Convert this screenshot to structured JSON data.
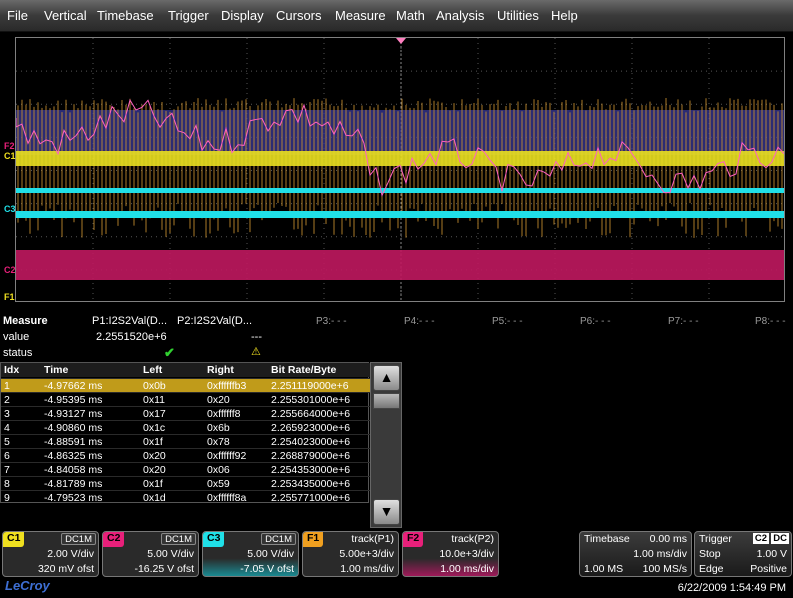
{
  "menu": [
    "File",
    "Vertical",
    "Timebase",
    "Trigger",
    "Display",
    "Cursors",
    "Measure",
    "Math",
    "Analysis",
    "Utilities",
    "Help"
  ],
  "channel_markers": {
    "f2": "F2",
    "c1": "C1",
    "c3": "C3",
    "c2": "C2",
    "f1": "F1"
  },
  "measure": {
    "title": "Measure",
    "p1_name": "P1:I2S2Val(D...",
    "p2_name": "P2:I2S2Val(D...",
    "value_label": "value",
    "p1_value": "2.2551520e+6",
    "p2_value": "---",
    "status_label": "status",
    "p3": "P3:- - -",
    "p4": "P4:- - -",
    "p5": "P5:- - -",
    "p6": "P6:- - -",
    "p7": "P7:- - -",
    "p8": "P8:- - -"
  },
  "table": {
    "headers": [
      "Idx",
      "Time",
      "Left",
      "Right",
      "Bit Rate/Byte"
    ],
    "rows": [
      [
        "1",
        "-4.97662 ms",
        "0x0b",
        "0xffffffb3",
        "2.251119000e+6"
      ],
      [
        "2",
        "-4.95395 ms",
        "0x11",
        "0x20",
        "2.255301000e+6"
      ],
      [
        "3",
        "-4.93127 ms",
        "0x17",
        "0xffffff8",
        "2.255664000e+6"
      ],
      [
        "4",
        "-4.90860 ms",
        "0x1c",
        "0x6b",
        "2.265923000e+6"
      ],
      [
        "5",
        "-4.88591 ms",
        "0x1f",
        "0x78",
        "2.254023000e+6"
      ],
      [
        "6",
        "-4.86325 ms",
        "0x20",
        "0xffffff92",
        "2.268879000e+6"
      ],
      [
        "7",
        "-4.84058 ms",
        "0x20",
        "0x06",
        "2.254353000e+6"
      ],
      [
        "8",
        "-4.81789 ms",
        "0x1f",
        "0x59",
        "2.253435000e+6"
      ],
      [
        "9",
        "-4.79523 ms",
        "0x1d",
        "0xffffff8a",
        "2.255771000e+6"
      ]
    ],
    "selected_row": 0
  },
  "descriptors": {
    "c1": {
      "label": "C1",
      "tag": "DC1M",
      "line1": "2.00 V/div",
      "line2": "320 mV ofst",
      "color": "#f0e020"
    },
    "c2": {
      "label": "C2",
      "tag": "DC1M",
      "line1": "5.00 V/div",
      "line2": "-16.25 V ofst",
      "color": "#e8207a"
    },
    "c3": {
      "label": "C3",
      "tag": "DC1M",
      "line1": "5.00 V/div",
      "line2": "-7.05 V ofst",
      "color": "#20e0e8"
    },
    "f1": {
      "label": "F1",
      "header": "track(P1)",
      "line1": "5.00e+3/div",
      "line2": "1.00 ms/div",
      "color": "#f0a020"
    },
    "f2": {
      "label": "F2",
      "header": "track(P2)",
      "line1": "10.0e+3/div",
      "line2": "1.00 ms/div",
      "color": "#e8207a"
    }
  },
  "timebase": {
    "label": "Timebase",
    "delay": "0.00 ms",
    "per_div": "1.00 ms/div",
    "samples": "1.00 MS",
    "rate": "100 MS/s"
  },
  "trigger": {
    "label": "Trigger",
    "source": "C2",
    "coupling": "DC",
    "mode": "Stop",
    "level": "1.00 V",
    "type": "Edge",
    "slope": "Positive"
  },
  "brand": "LeCroy",
  "datetime": "6/22/2009 1:54:49 PM"
}
